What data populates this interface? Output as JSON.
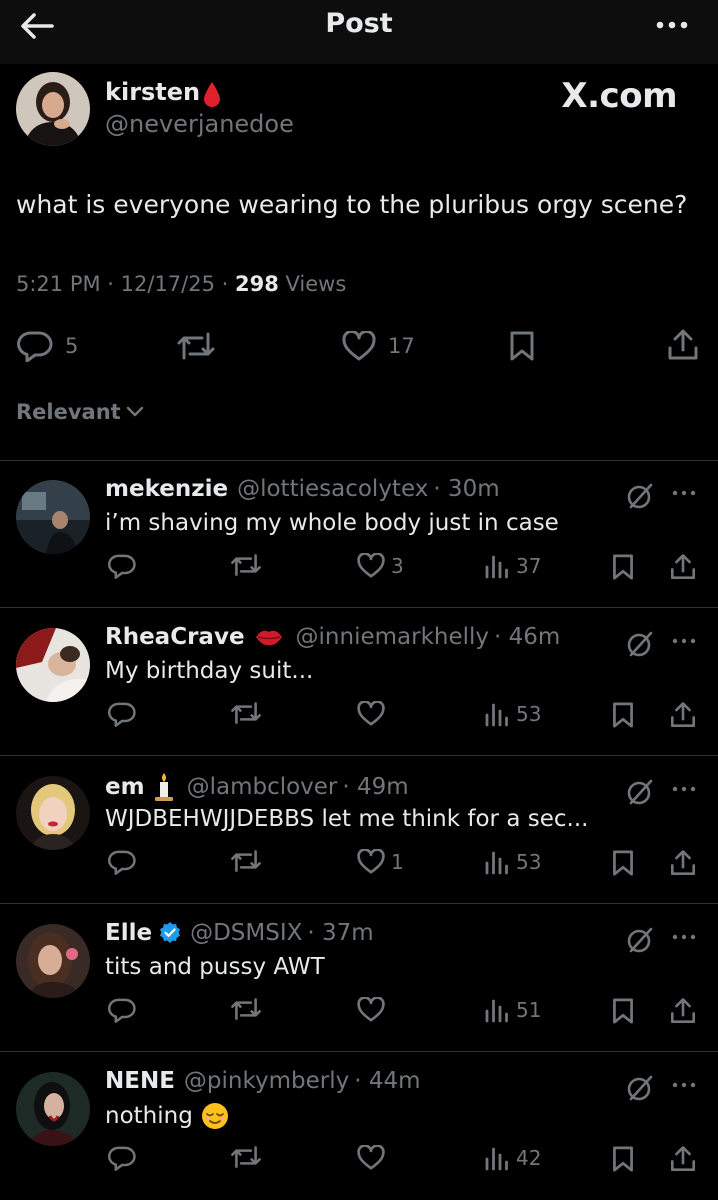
{
  "header": {
    "title": "Post"
  },
  "post": {
    "name": "kirsten",
    "name_icon": "blood-drop-icon",
    "handle": "@neverjanedoe",
    "watermark": "X.com",
    "text": "what is everyone wearing to the pluribus orgy scene?",
    "time": "5:21 PM · 12/17/25 · ",
    "views_count": "298",
    "views_label": " Views",
    "replies": "5",
    "likes": "17"
  },
  "sort": {
    "label": "Relevant"
  },
  "replies": [
    {
      "name": "mekenzie",
      "name_icon": "",
      "handle": "@lottiesacolytex",
      "time": "· 30m",
      "text": "i’m shaving my whole body just in case",
      "likes": "3",
      "views": "37"
    },
    {
      "name": "RheaCrave",
      "name_icon": "lips-icon",
      "handle": "@inniemarkhelly",
      "time": "· 46m",
      "text": "My birthday suit...",
      "likes": "",
      "views": "53"
    },
    {
      "name": "em",
      "name_icon": "candle-icon",
      "handle": "@lambclover",
      "time": "· 49m",
      "text": "WJDBEHWJJDEBBS let me think for a sec...",
      "likes": "1",
      "views": "53"
    },
    {
      "name": "Elle",
      "name_icon": "verified-badge-icon",
      "handle": "@DSMSIX",
      "time": "· 37m",
      "text": "tits and pussy AWT",
      "likes": "",
      "views": "51"
    },
    {
      "name": "NENE",
      "name_icon": "",
      "handle": "@pinkymberly",
      "time": "· 44m",
      "text": "nothing",
      "text_emoji": "relieved-face-icon",
      "likes": "",
      "views": "42"
    }
  ],
  "colors": {
    "background": "#000000",
    "text": "#e7e9ea",
    "muted": "#71767b",
    "divider": "#2f3336",
    "verified": "#1d9bf0",
    "blood": "#e0212d"
  }
}
